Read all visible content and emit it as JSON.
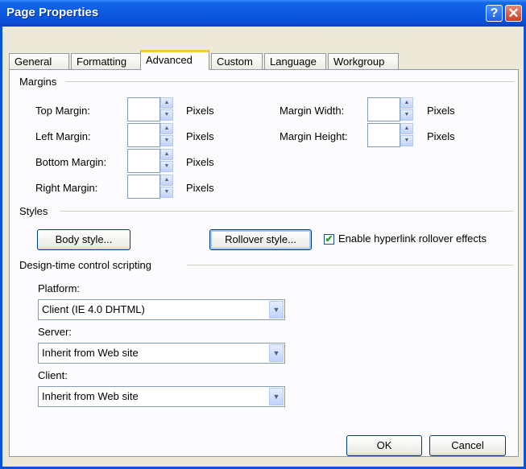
{
  "window": {
    "title": "Page Properties",
    "help_glyph": "?",
    "close_glyph": "✕"
  },
  "tabs": [
    {
      "label": "General"
    },
    {
      "label": "Formatting"
    },
    {
      "label": "Advanced"
    },
    {
      "label": "Custom"
    },
    {
      "label": "Language"
    },
    {
      "label": "Workgroup"
    }
  ],
  "active_tab": "Advanced",
  "margins": {
    "group_label": "Margins",
    "unit": "Pixels",
    "top_margin_label": "Top Margin:",
    "left_margin_label": "Left Margin:",
    "bottom_margin_label": "Bottom Margin:",
    "right_margin_label": "Right Margin:",
    "margin_width_label": "Margin Width:",
    "margin_height_label": "Margin Height:",
    "top_margin_value": "",
    "left_margin_value": "",
    "bottom_margin_value": "",
    "right_margin_value": "",
    "margin_width_value": "",
    "margin_height_value": ""
  },
  "styles": {
    "group_label": "Styles",
    "body_style_button": "Body style...",
    "rollover_style_button": "Rollover style...",
    "rollover_checkbox_label": "Enable hyperlink rollover effects",
    "rollover_checked": true
  },
  "scripting": {
    "group_label": "Design-time control scripting",
    "platform_label": "Platform:",
    "platform_value": "Client (IE 4.0 DHTML)",
    "server_label": "Server:",
    "server_value": "Inherit from Web site",
    "client_label": "Client:",
    "client_value": "Inherit from Web site"
  },
  "footer": {
    "ok_label": "OK",
    "cancel_label": "Cancel"
  },
  "colors": {
    "title_bar": "#0a53d8",
    "dialog_bg": "#ece9d8",
    "panel_bg": "#fcfcfe",
    "active_tab_highlight": "#ffc83c",
    "check_mark": "#21a121"
  }
}
